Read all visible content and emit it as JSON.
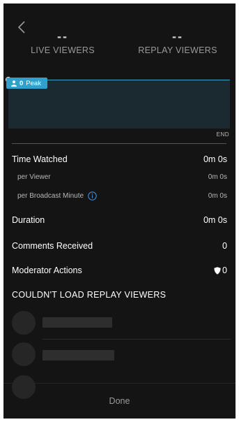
{
  "header": {
    "back_icon": "chevron-left-icon",
    "live_viewers": {
      "value": "--",
      "label": "LIVE VIEWERS"
    },
    "replay_viewers": {
      "value": "--",
      "label": "REPLAY VIEWERS"
    }
  },
  "chart": {
    "peak_icon": "person-icon",
    "peak_count": "0",
    "peak_label": "Peak",
    "end_label": "END",
    "line_color": "#3ba3c6",
    "fill_color": "#1b2a31"
  },
  "metrics": {
    "time_watched": {
      "label": "Time Watched",
      "value": "0m 0s"
    },
    "per_viewer": {
      "label": "per Viewer",
      "value": "0m 0s"
    },
    "per_broadcast_minute": {
      "label": "per Broadcast Minute",
      "value": "0m 0s",
      "icon": "info-icon"
    },
    "duration": {
      "label": "Duration",
      "value": "0m 0s"
    },
    "comments_received": {
      "label": "Comments Received",
      "value": "0"
    },
    "moderator_actions": {
      "label": "Moderator Actions",
      "value": "0",
      "icon": "shield-icon"
    }
  },
  "replay_section": {
    "title": "COULDN'T LOAD REPLAY VIEWERS"
  },
  "footer": {
    "done_label": "Done"
  },
  "colors": {
    "background": "#141414",
    "accent": "#2fa1cc"
  }
}
